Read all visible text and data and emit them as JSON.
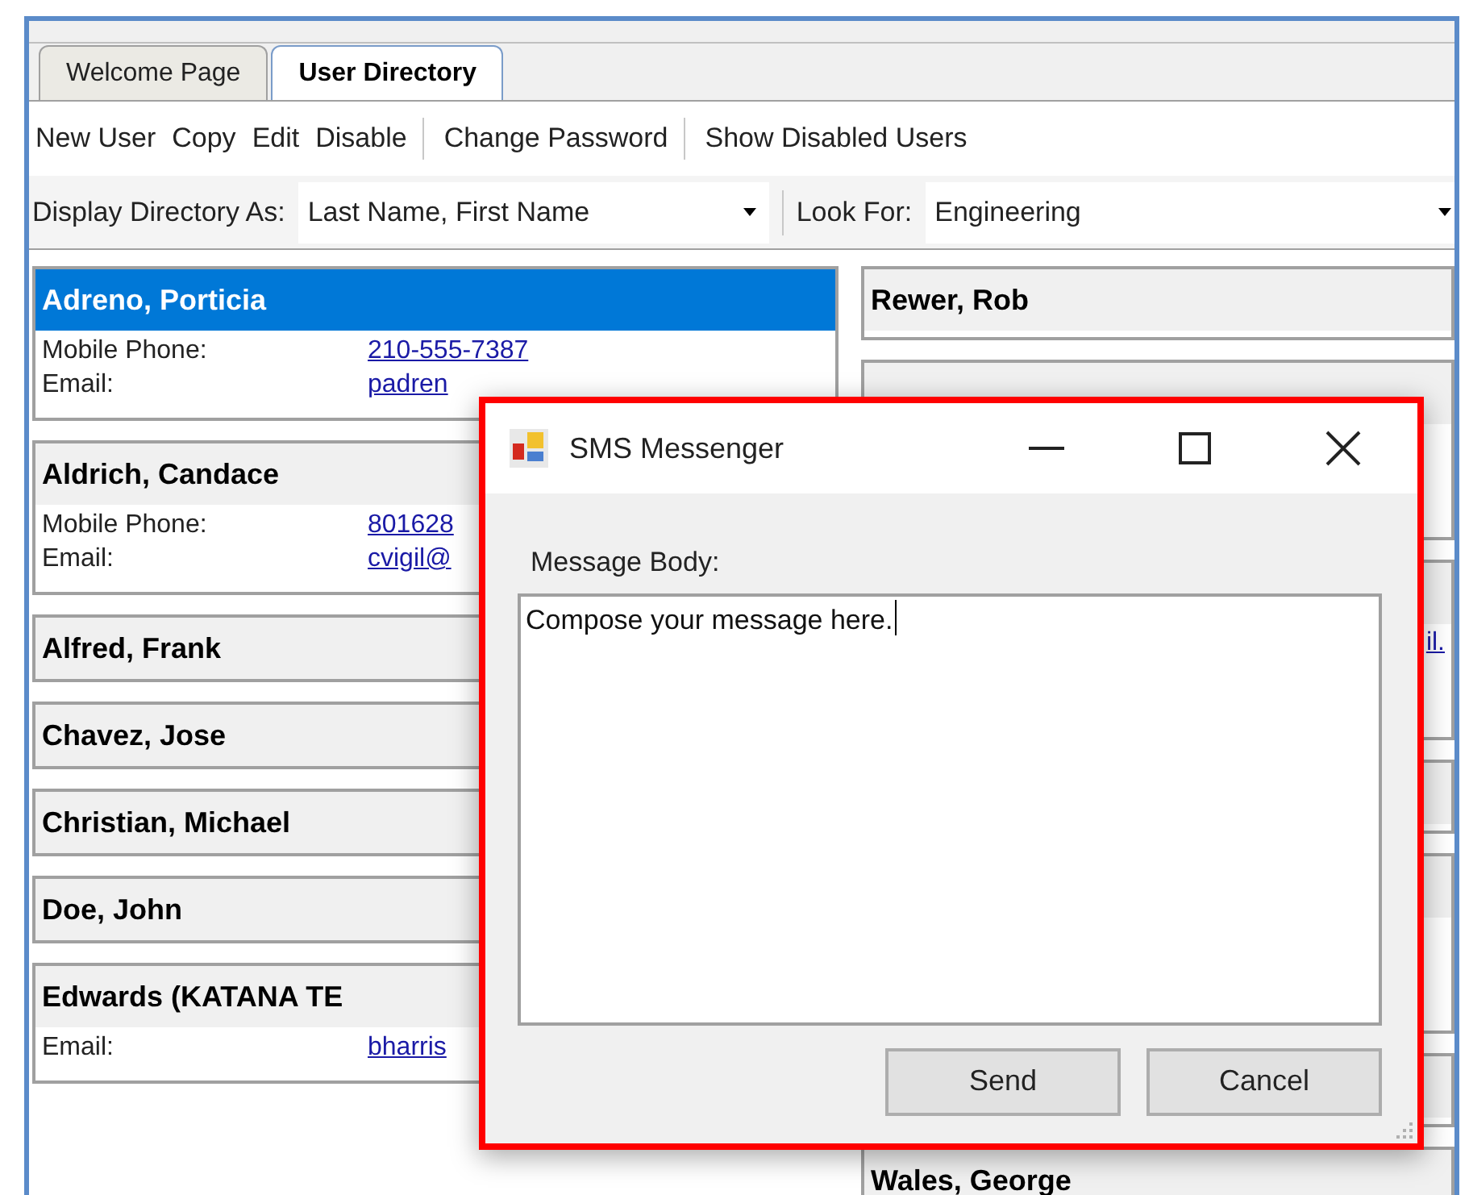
{
  "tabs": [
    {
      "label": "Welcome Page",
      "selected": false
    },
    {
      "label": "User Directory",
      "selected": true
    }
  ],
  "toolbar": {
    "groups": [
      [
        "New User",
        "Copy",
        "Edit",
        "Disable"
      ],
      [
        "Change Password"
      ],
      [
        "Show Disabled Users"
      ]
    ]
  },
  "filter_bar": {
    "display_label": "Display Directory As:",
    "display_value": "Last Name, First Name",
    "look_for_label": "Look For:",
    "look_for_value": "Engineering"
  },
  "left_cards": [
    {
      "name": "Adreno, Porticia",
      "selected": true,
      "details": [
        {
          "label": "Mobile Phone:",
          "value": "210-555-7387"
        },
        {
          "label": "Email:",
          "value": "padren"
        }
      ]
    },
    {
      "name": "Aldrich, Candace",
      "selected": false,
      "details": [
        {
          "label": "Mobile Phone:",
          "value": "801628"
        },
        {
          "label": "Email:",
          "value": "cvigil@"
        }
      ]
    },
    {
      "name": "Alfred, Frank",
      "selected": false
    },
    {
      "name": "Chavez, Jose",
      "selected": false
    },
    {
      "name": "Christian, Michael",
      "selected": false
    },
    {
      "name": "Doe, John",
      "selected": false
    },
    {
      "name": "Edwards (KATANA TE",
      "selected": false,
      "details": [
        {
          "label": "Email:",
          "value": "bharris"
        }
      ]
    }
  ],
  "right_cards": [
    {
      "name": "Rewer, Rob",
      "expanded": false
    },
    {
      "expanded": true
    },
    {
      "expanded": true,
      "link_fragment": "il."
    },
    {
      "expanded": false
    },
    {
      "expanded": true
    },
    {
      "expanded": false
    },
    {
      "name": "Wales, George"
    }
  ],
  "dialog": {
    "title": "SMS Messenger",
    "field_label": "Message Body:",
    "message": "Compose your message here.",
    "buttons": [
      "Send",
      "Cancel"
    ]
  }
}
